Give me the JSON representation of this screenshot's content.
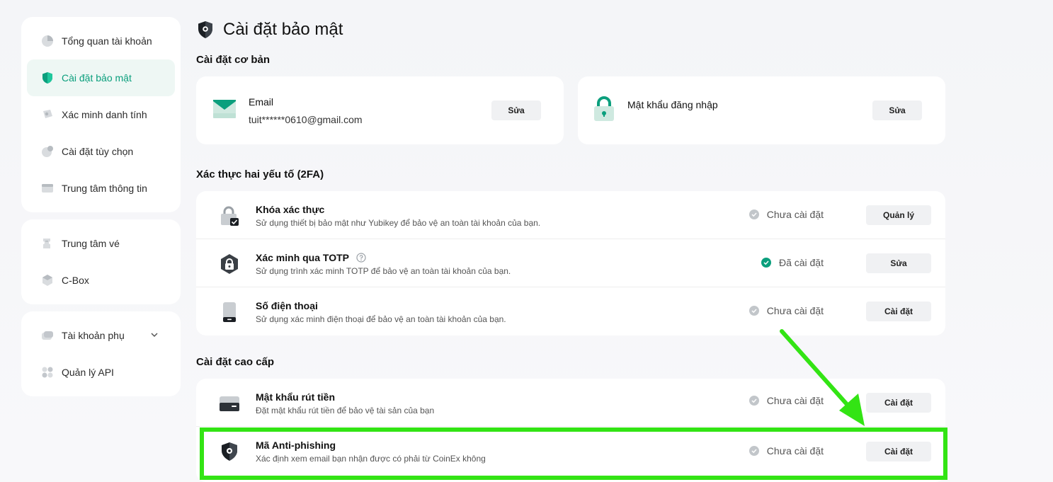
{
  "sidebar": {
    "groups": [
      {
        "items": [
          {
            "label": "Tổng quan tài khoản",
            "icon": "pie-chart-icon"
          },
          {
            "label": "Cài đặt bảo mật",
            "icon": "shield-icon",
            "active": true
          },
          {
            "label": "Xác minh danh tính",
            "icon": "id-badge-icon"
          },
          {
            "label": "Cài đặt tùy chọn",
            "icon": "preferences-icon"
          },
          {
            "label": "Trung tâm thông tin",
            "icon": "inbox-icon"
          }
        ]
      },
      {
        "items": [
          {
            "label": "Trung tâm vé",
            "icon": "ticket-icon"
          },
          {
            "label": "C-Box",
            "icon": "box-icon"
          }
        ]
      },
      {
        "items": [
          {
            "label": "Tài khoản phụ",
            "icon": "sub-account-icon"
          },
          {
            "label": "Quản lý API",
            "icon": "api-icon"
          }
        ]
      }
    ]
  },
  "page": {
    "title": "Cài đặt bảo mật"
  },
  "basic": {
    "section_title": "Cài đặt cơ bản",
    "email": {
      "label": "Email",
      "value": "tuit******0610@gmail.com",
      "button": "Sửa"
    },
    "password": {
      "label": "Mật khẩu đăng nhập",
      "button": "Sửa"
    }
  },
  "twofa": {
    "section_title": "Xác thực hai yếu tố (2FA)",
    "rows": [
      {
        "title": "Khóa xác thực",
        "desc": "Sử dụng thiết bị bảo mật như Yubikey để bảo vệ an toàn tài khoản của bạn.",
        "status": "Chưa cài đặt",
        "button": "Quản lý"
      },
      {
        "title": "Xác minh qua TOTP",
        "desc": "Sử dụng trình xác minh TOTP để bảo vệ an toàn tài khoản của bạn.",
        "status": "Đã cài đặt",
        "button": "Sửa"
      },
      {
        "title": "Số điện thoại",
        "desc": "Sử dụng xác minh điện thoại để bảo vệ an toàn tài khoản của bạn.",
        "status": "Chưa cài đặt",
        "button": "Cài đặt"
      }
    ]
  },
  "advanced": {
    "section_title": "Cài đặt cao cấp",
    "rows": [
      {
        "title": "Mật khẩu rút tiền",
        "desc": "Đặt mật khẩu rút tiền để bảo vệ tài sản của bạn",
        "status": "Chưa cài đặt",
        "button": "Cài đặt"
      },
      {
        "title": "Mã Anti-phishing",
        "desc": "Xác định xem email bạn nhận được có phải từ CoinEx không",
        "status": "Chưa cài đặt",
        "button": "Cài đặt"
      }
    ]
  },
  "colors": {
    "accent": "#0b9f7d",
    "annotation": "#33e414"
  }
}
